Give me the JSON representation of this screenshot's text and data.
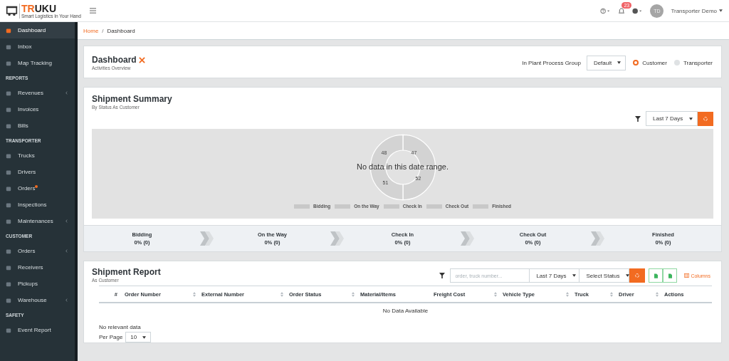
{
  "brand": {
    "name_a": "TR",
    "name_b": "UKU",
    "tagline": "Smart Logistics In Your Hand"
  },
  "topbar": {
    "notifications": "23",
    "avatar": "TD",
    "user": "Transporter Demo"
  },
  "sidebar": [
    {
      "items": [
        {
          "label": "Dashboard",
          "selected": true,
          "submenu": false,
          "dot": false
        },
        {
          "label": "Inbox",
          "selected": false,
          "submenu": false,
          "dot": false
        },
        {
          "label": "Map Tracking",
          "selected": false,
          "submenu": false,
          "dot": false
        }
      ]
    },
    {
      "header": "REPORTS",
      "items": [
        {
          "label": "Revenues",
          "selected": false,
          "submenu": true,
          "dot": false
        },
        {
          "label": "Invoices",
          "selected": false,
          "submenu": false,
          "dot": false
        },
        {
          "label": "Bills",
          "selected": false,
          "submenu": false,
          "dot": false
        }
      ]
    },
    {
      "header": "TRANSPORTER",
      "items": [
        {
          "label": "Trucks",
          "selected": false,
          "submenu": false,
          "dot": false
        },
        {
          "label": "Drivers",
          "selected": false,
          "submenu": false,
          "dot": false
        },
        {
          "label": "Orders",
          "selected": false,
          "submenu": false,
          "dot": true
        },
        {
          "label": "Inspections",
          "selected": false,
          "submenu": false,
          "dot": false
        },
        {
          "label": "Maintenances",
          "selected": false,
          "submenu": true,
          "dot": false
        }
      ]
    },
    {
      "header": "CUSTOMER",
      "items": [
        {
          "label": "Orders",
          "selected": false,
          "submenu": true,
          "dot": false
        },
        {
          "label": "Receivers",
          "selected": false,
          "submenu": false,
          "dot": false
        },
        {
          "label": "Pickups",
          "selected": false,
          "submenu": false,
          "dot": false
        },
        {
          "label": "Warehouse",
          "selected": false,
          "submenu": true,
          "dot": false
        }
      ]
    },
    {
      "header": "SAFETY",
      "items": [
        {
          "label": "Event Report",
          "selected": false,
          "submenu": false,
          "dot": false
        }
      ]
    }
  ],
  "breadcrumb": {
    "home": "Home",
    "separator": "/",
    "current": "Dashboard"
  },
  "dashboard": {
    "title": "Dashboard",
    "subtitle": "Activities Overview",
    "group_label": "In Plant Process Group",
    "group_value": "Default",
    "roles": [
      {
        "label": "Customer",
        "selected": true
      },
      {
        "label": "Transporter",
        "selected": false
      }
    ]
  },
  "summary": {
    "title": "Shipment Summary",
    "subtitle": "By Status As Customer",
    "range": "Last 7 Days",
    "chart": {
      "message": "No data in this date range.",
      "slice_labels": [
        "47",
        "52",
        "51",
        "48"
      ],
      "legend": [
        "Bidding",
        "On the Way",
        "Check In",
        "Check Out",
        "Finished"
      ]
    },
    "steps": [
      {
        "label": "Bidding",
        "value": "0% (0)"
      },
      {
        "label": "On the Way",
        "value": "0% (0)"
      },
      {
        "label": "Check In",
        "value": "0% (0)"
      },
      {
        "label": "Check Out",
        "value": "0% (0)"
      },
      {
        "label": "Finished",
        "value": "0% (0)"
      }
    ]
  },
  "report": {
    "title": "Shipment Report",
    "subtitle": "As Customer",
    "search": {
      "placeholder": "order, truck number..."
    },
    "range": "Last 7 Days",
    "status": "Select Status",
    "columns_link": "Columns",
    "columns": [
      {
        "label": "#",
        "sortable": false
      },
      {
        "label": "Order Number",
        "sortable": true
      },
      {
        "label": "External Number",
        "sortable": true
      },
      {
        "label": "Order Status",
        "sortable": true
      },
      {
        "label": "Material/Items",
        "sortable": false
      },
      {
        "label": "Freight Cost",
        "sortable": true
      },
      {
        "label": "Vehicle Type",
        "sortable": true
      },
      {
        "label": "Truck",
        "sortable": true
      },
      {
        "label": "Driver",
        "sortable": true
      },
      {
        "label": "Actions",
        "sortable": false
      }
    ],
    "empty": "No Data Available",
    "footer_note": "No relevant data",
    "per_page_label": "Per Page",
    "per_page": "10"
  }
}
